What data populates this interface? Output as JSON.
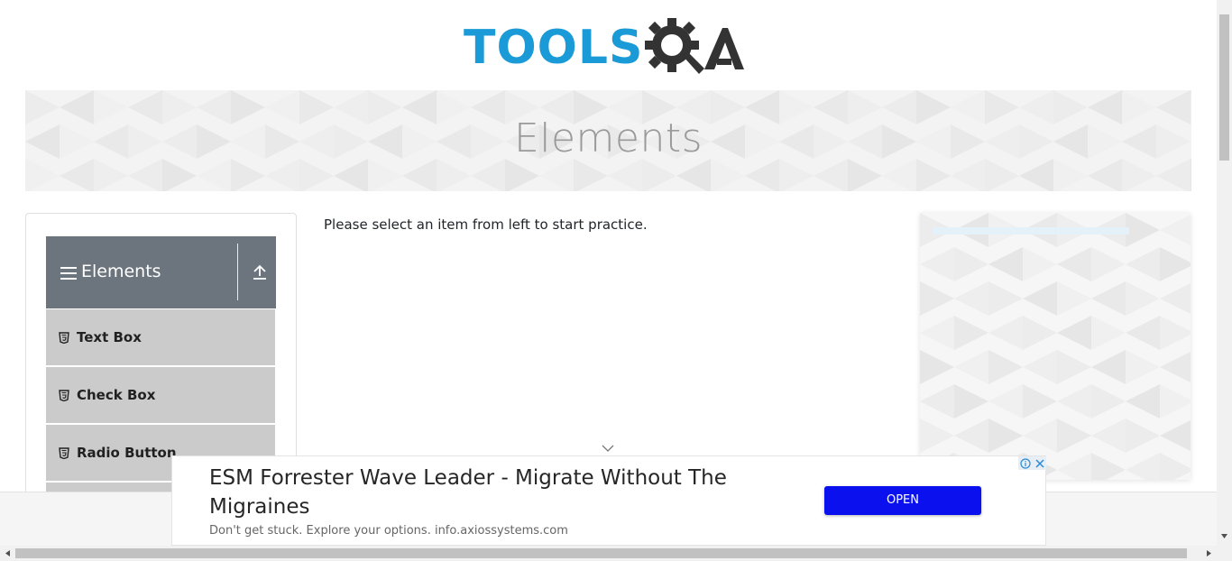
{
  "brand": {
    "logo_text": "TOOLSQA",
    "logo_visible_prefix": "TOOLS",
    "primary_color": "#1a9ad6",
    "dark_color": "#333333"
  },
  "banner": {
    "title": "Elements"
  },
  "sidebar": {
    "group_title": "Elements",
    "group_icon": "hamburger-menu-icon",
    "collapse_icon": "upload-arrow-icon",
    "items": [
      {
        "label": "Text Box",
        "icon": "html5-icon"
      },
      {
        "label": "Check Box",
        "icon": "html5-icon"
      },
      {
        "label": "Radio Button",
        "icon": "html5-icon"
      }
    ],
    "header_color": "#6c757d",
    "item_color": "#cbcbcb"
  },
  "main": {
    "instruction": "Please select an item from left to start practice."
  },
  "bottom_ad": {
    "headline": "ESM Forrester Wave Leader - Migrate Without The Migraines",
    "subtext": "Don't get stuck. Explore your options. info.axiossystems.com",
    "button_label": "OPEN",
    "button_color": "#0a10ee"
  }
}
